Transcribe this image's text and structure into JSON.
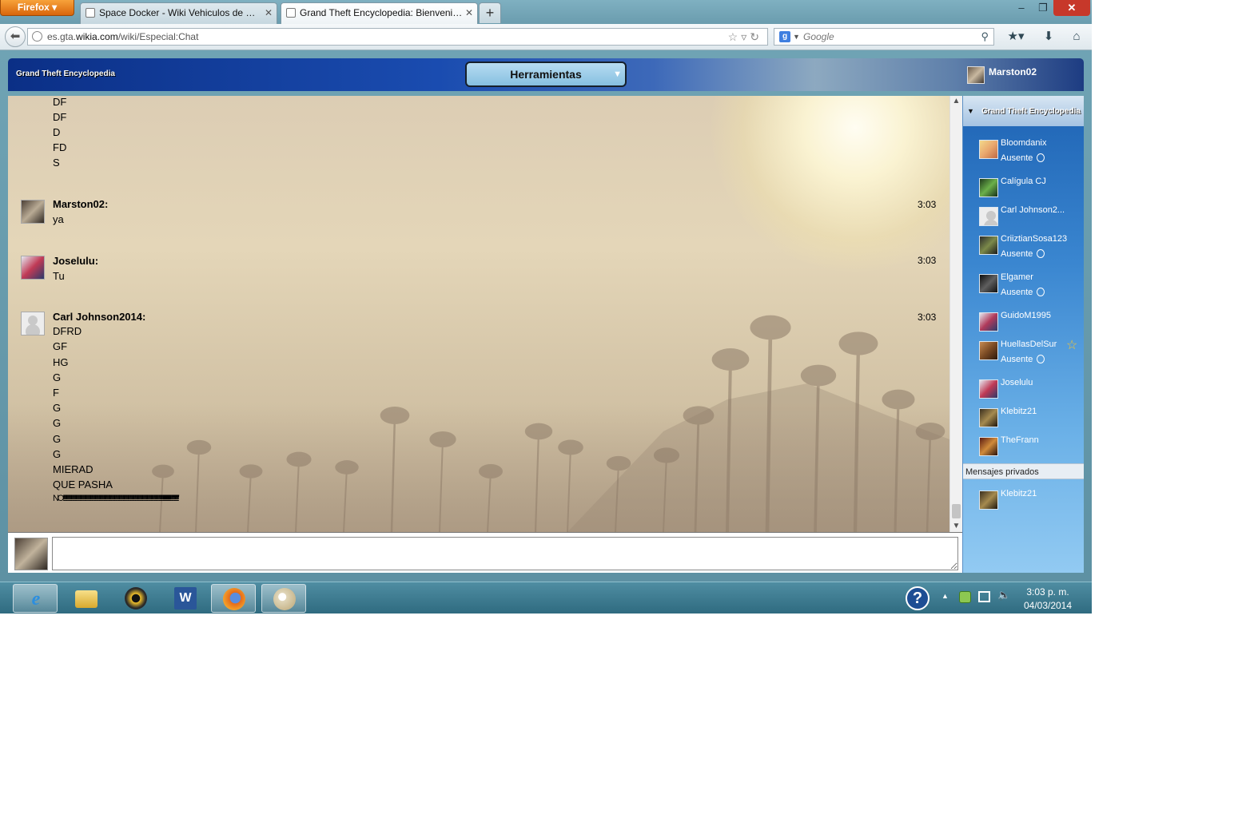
{
  "browser": {
    "menu_button": "Firefox",
    "tabs": [
      {
        "label": "Space Docker - Wiki Vehiculos de Gra...",
        "active": false
      },
      {
        "label": "Grand Theft Encyclopedia: Bienvenid...",
        "active": true
      }
    ],
    "new_tab": "+",
    "window_controls": {
      "minimize": "–",
      "maximize": "❐",
      "close": "✕"
    },
    "url": {
      "prefix": "es.gta.",
      "domain": "wikia.com",
      "path": "/wiki/Especial:Chat"
    },
    "search": {
      "engine_glyph": "g",
      "placeholder": "Google"
    }
  },
  "chat": {
    "wiki_name": "Grand Theft Encyclopedia",
    "tools_button": "Herramientas",
    "current_user": "Marston02",
    "messages": [
      {
        "user": "",
        "time": "",
        "lines": [
          "DF",
          "DF",
          "D",
          "FD",
          "S"
        ]
      },
      {
        "user": "Marston02:",
        "time": "3:03",
        "lines": [
          "ya"
        ]
      },
      {
        "user": "Joselulu:",
        "time": "3:03",
        "lines": [
          "Tu"
        ]
      },
      {
        "user": "Carl Johnson2014:",
        "time": "3:03",
        "lines": [
          "DFRD",
          "GF",
          "HG",
          "G",
          "F",
          "G",
          "G",
          "G",
          "G",
          "MIERAD",
          "QUE PASHA",
          "NO!!!!!!!!!!!!!!!!!!!!!!!!!!!!!!!!!!!!!!!!!!!!!!!!!!!!!!!!!!!!!!!!!!!!!!!!!!!!!!!!!!!!!!!!!!!!!!!!!!!!!!!!!!!!!!!!!!!!!!!!!!!!!!!!!!!!!!!!!!!!!!!!!!!!!!!!!!!!!''''''''''''''''''''''''''''''''''''''''''''''''''''''''''''''''''''''''''''''''''''''''''''''''!!!!!!!!!!!!!!!!!!!!!!!''''''''''''''''''''''''''''''''''''''''''''''''''''''''''''''''''''''"
        ]
      }
    ],
    "input_value": "",
    "room": {
      "name": "Grand Theft Encyclopedia",
      "users": [
        {
          "name": "Bloomdanix",
          "status": "Ausente"
        },
        {
          "name": "Calígula CJ",
          "status": ""
        },
        {
          "name": "Carl Johnson2...",
          "status": ""
        },
        {
          "name": "CriiztianSosa123",
          "status": "Ausente"
        },
        {
          "name": "Elgamer",
          "status": "Ausente"
        },
        {
          "name": "GuidoM1995",
          "status": ""
        },
        {
          "name": "HuellasDelSur",
          "status": "Ausente",
          "starred": true
        },
        {
          "name": "Joselulu",
          "status": ""
        },
        {
          "name": "Klebitz21",
          "status": ""
        },
        {
          "name": "TheFrann",
          "status": ""
        }
      ]
    },
    "private_header": "Mensajes privados",
    "private_users": [
      {
        "name": "Klebitz21"
      }
    ]
  },
  "taskbar": {
    "apps": [
      "Internet Explorer",
      "File Explorer",
      "Media Player",
      "Word",
      "Firefox",
      "Paint"
    ],
    "help_glyph": "?",
    "clock_time": "3:03 p. m.",
    "clock_date": "04/03/2014"
  },
  "colors": {
    "accent": "#1e63b4",
    "header": "#0b2f86",
    "close": "#c7382a"
  }
}
